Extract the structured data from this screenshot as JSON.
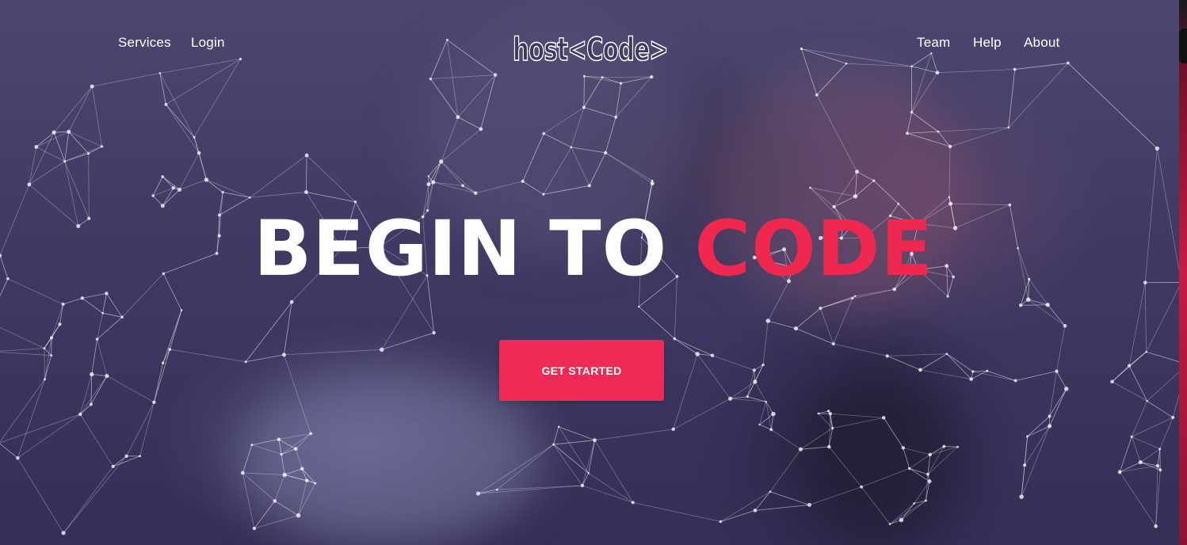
{
  "nav": {
    "left": [
      {
        "label": "Services"
      },
      {
        "label": "Login"
      }
    ],
    "right": [
      {
        "label": "Team"
      },
      {
        "label": "Help"
      },
      {
        "label": "About"
      }
    ]
  },
  "logo": {
    "text": "host<Code>"
  },
  "hero": {
    "headline_main": "BEGIN TO ",
    "headline_accent": "CODE",
    "cta_label": "GET STARTED"
  },
  "colors": {
    "accent": "#ee2a55",
    "overlay": "#3e3a63",
    "text": "#ffffff"
  },
  "icons": {
    "background": "particle-network"
  }
}
